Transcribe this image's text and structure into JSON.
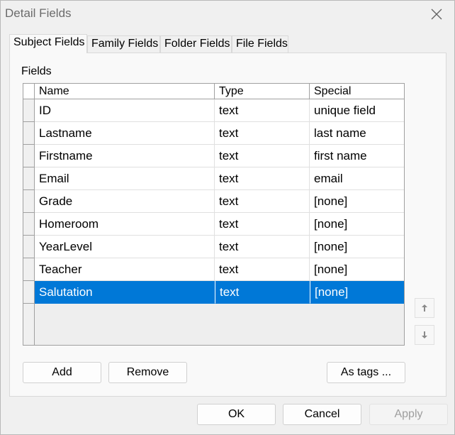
{
  "window": {
    "title": "Detail Fields"
  },
  "tabs": [
    {
      "label": "Subject Fields",
      "active": true
    },
    {
      "label": "Family Fields",
      "active": false
    },
    {
      "label": "Folder Fields",
      "active": false
    },
    {
      "label": "File Fields",
      "active": false
    }
  ],
  "panel": {
    "fields_label": "Fields",
    "columns": [
      "Name",
      "Type",
      "Special"
    ],
    "rows": [
      {
        "name": "ID",
        "type": "text",
        "special": "unique field"
      },
      {
        "name": "Lastname",
        "type": "text",
        "special": "last name"
      },
      {
        "name": "Firstname",
        "type": "text",
        "special": "first name"
      },
      {
        "name": "Email",
        "type": "text",
        "special": "email"
      },
      {
        "name": "Grade",
        "type": "text",
        "special": "[none]"
      },
      {
        "name": "Homeroom",
        "type": "text",
        "special": "[none]"
      },
      {
        "name": "YearLevel",
        "type": "text",
        "special": "[none]"
      },
      {
        "name": "Teacher",
        "type": "text",
        "special": "[none]"
      },
      {
        "name": "Salutation",
        "type": "text",
        "special": "[none]",
        "selected": true
      }
    ],
    "add_label": "Add",
    "remove_label": "Remove",
    "as_tags_label": "As tags ..."
  },
  "footer": {
    "ok_label": "OK",
    "cancel_label": "Cancel",
    "apply_label": "Apply"
  },
  "colors": {
    "selection": "#0078d7",
    "window_bg": "#f0f0f0"
  },
  "icons": {
    "close": "close-icon",
    "move_up": "arrow-up-icon",
    "move_down": "arrow-down-icon"
  }
}
